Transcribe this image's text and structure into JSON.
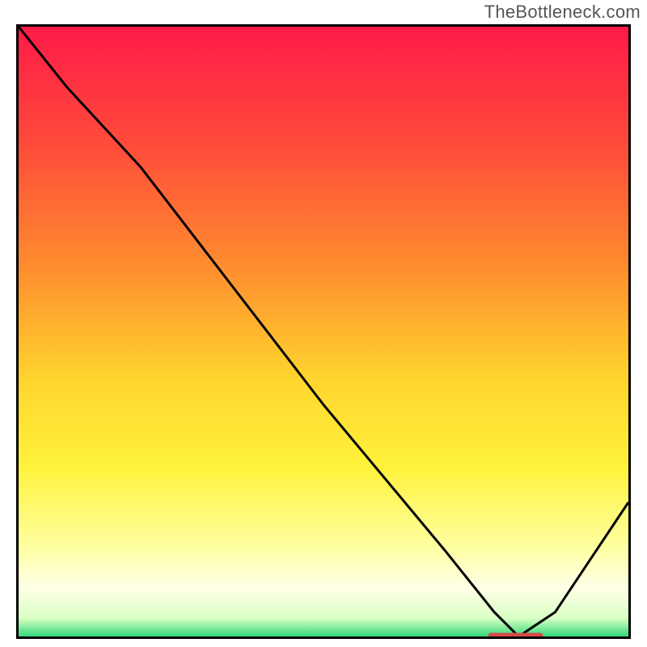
{
  "watermark": "TheBottleneck.com",
  "colors": {
    "gradient_stops": [
      {
        "offset": 0.0,
        "color": "#ff1a49"
      },
      {
        "offset": 0.2,
        "color": "#ff4d3a"
      },
      {
        "offset": 0.4,
        "color": "#ff8f2e"
      },
      {
        "offset": 0.58,
        "color": "#ffd52e"
      },
      {
        "offset": 0.72,
        "color": "#fff23a"
      },
      {
        "offset": 0.85,
        "color": "#ffff9e"
      },
      {
        "offset": 0.92,
        "color": "#ffffe8"
      },
      {
        "offset": 0.97,
        "color": "#d9ffc4"
      },
      {
        "offset": 1.0,
        "color": "#33d97a"
      }
    ],
    "frame": "#000000",
    "curve": "#000000",
    "marker": "#d64a4a"
  },
  "chart_data": {
    "type": "line",
    "title": "",
    "xlabel": "",
    "ylabel": "",
    "xlim": [
      0,
      100
    ],
    "ylim": [
      0,
      100
    ],
    "x": [
      0,
      8,
      20,
      30,
      40,
      50,
      60,
      70,
      78,
      82,
      88,
      94,
      100
    ],
    "values": [
      100,
      90,
      77,
      64,
      51,
      38,
      26,
      14,
      4,
      0,
      4,
      13,
      22
    ],
    "minimum": {
      "x_range": [
        77,
        86
      ],
      "value": 0
    },
    "marker_band": {
      "x_start": 77,
      "x_end": 86,
      "y": 0
    }
  }
}
